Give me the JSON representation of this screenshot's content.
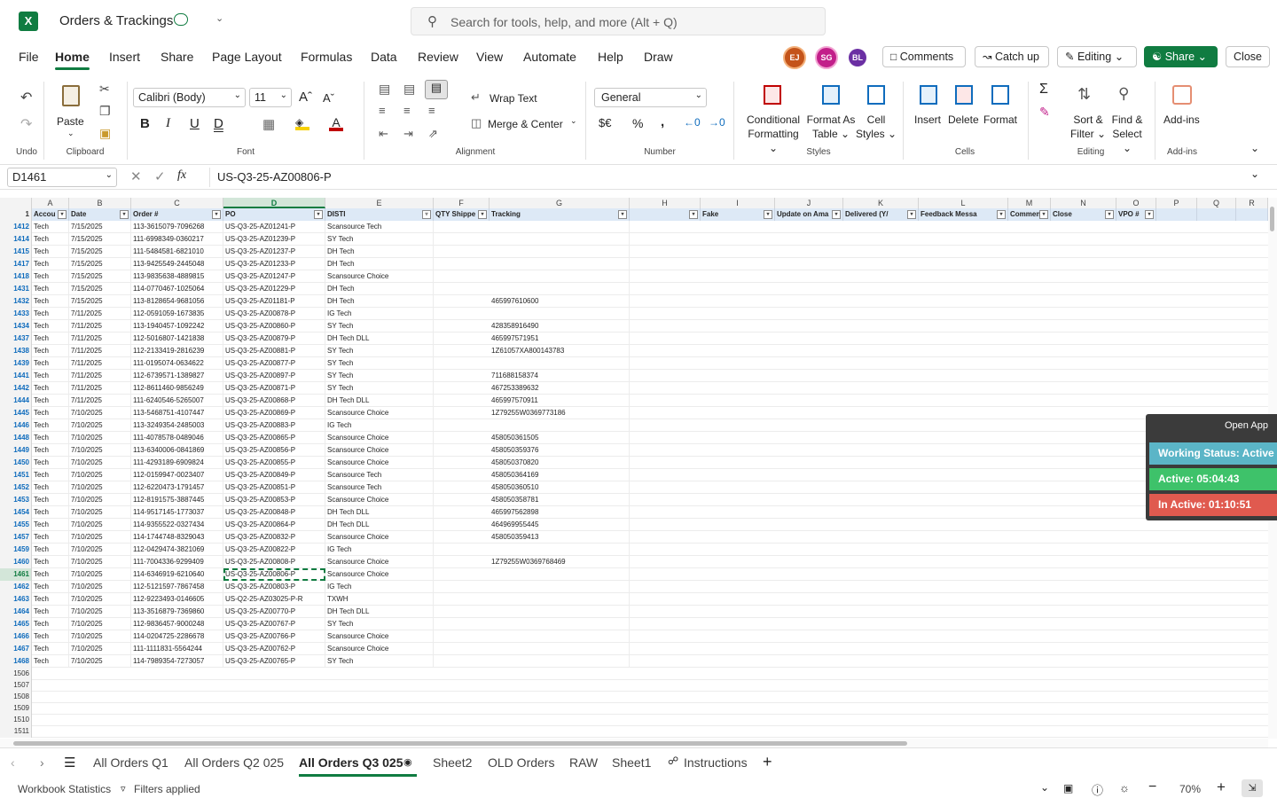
{
  "app": {
    "title": "Orders & Trackings",
    "search_placeholder": "Search for tools, help, and more (Alt + Q)",
    "brand_color": "#107c41"
  },
  "menu": [
    "File",
    "Home",
    "Insert",
    "Share",
    "Page Layout",
    "Formulas",
    "Data",
    "Review",
    "View",
    "Automate",
    "Help",
    "Draw"
  ],
  "active_menu": "Home",
  "avatars": [
    {
      "initials": "EJ",
      "color": "#c4541a"
    },
    {
      "initials": "SG",
      "color": "#c21f8a"
    },
    {
      "initials": "BL",
      "color": "#6b2fa3"
    }
  ],
  "header_buttons": {
    "comments": "Comments",
    "catchup": "Catch up",
    "editing": "Editing",
    "share": "Share",
    "close": "Close"
  },
  "ribbon": {
    "undo_label": "Undo",
    "clipboard_label": "Clipboard",
    "paste": "Paste",
    "font_label": "Font",
    "font_name": "Calibri (Body)",
    "font_size": "11",
    "alignment_label": "Alignment",
    "wrap_text": "Wrap Text",
    "merge_center": "Merge & Center",
    "number_label": "Number",
    "number_format": "General",
    "styles_label": "Styles",
    "conditional": "Conditional",
    "formatting": "Formatting",
    "format_as": "Format As",
    "table": "Table",
    "cell": "Cell",
    "styles": "Styles",
    "cells_label": "Cells",
    "insert": "Insert",
    "delete": "Delete",
    "format": "Format",
    "editing_label": "Editing",
    "sort1": "Sort &",
    "sort2": "Filter",
    "find1": "Find &",
    "find2": "Select",
    "addins_label": "Add-ins",
    "addins": "Add-ins"
  },
  "formula_bar": {
    "name_box": "D1461",
    "formula": "US-Q3-25-AZ00806-P"
  },
  "columns": [
    "A",
    "B",
    "C",
    "D",
    "E",
    "F",
    "G",
    "H",
    "I",
    "J",
    "K",
    "L",
    "M",
    "N",
    "O",
    "P",
    "Q",
    "R"
  ],
  "header_row": {
    "row_number": "1",
    "labels": [
      "Accou",
      "Date",
      "Order #",
      "PO",
      "DISTI",
      "QTY Shippe",
      "Tracking",
      "",
      "Fake",
      "Update on Ama",
      "Delivered (Y/",
      "Feedback Messa",
      "Comments",
      "Close",
      "VPO #",
      "",
      "",
      ""
    ]
  },
  "rows": [
    [
      "1412",
      "Tech",
      "7/15/2025",
      "113-3615079-7096268",
      "US-Q3-25-AZ01241-P",
      "Scansource Tech",
      ""
    ],
    [
      "1414",
      "Tech",
      "7/15/2025",
      "111-6998349-0360217",
      "US-Q3-25-AZ01239-P",
      "SY Tech",
      ""
    ],
    [
      "1415",
      "Tech",
      "7/15/2025",
      "111-5484581-6821010",
      "US-Q3-25-AZ01237-P",
      "DH Tech",
      ""
    ],
    [
      "1417",
      "Tech",
      "7/15/2025",
      "113-9425549-2445048",
      "US-Q3-25-AZ01233-P",
      "DH Tech",
      ""
    ],
    [
      "1418",
      "Tech",
      "7/15/2025",
      "113-9835638-4889815",
      "US-Q3-25-AZ01247-P",
      "Scansource Choice",
      ""
    ],
    [
      "1431",
      "Tech",
      "7/15/2025",
      "114-0770467-1025064",
      "US-Q3-25-AZ01229-P",
      "DH Tech",
      ""
    ],
    [
      "1432",
      "Tech",
      "7/15/2025",
      "113-8128654-9681056",
      "US-Q3-25-AZ01181-P",
      "DH Tech",
      "465997610600"
    ],
    [
      "1433",
      "Tech",
      "7/11/2025",
      "112-0591059-1673835",
      "US-Q3-25-AZ00878-P",
      "IG Tech",
      ""
    ],
    [
      "1434",
      "Tech",
      "7/11/2025",
      "113-1940457-1092242",
      "US-Q3-25-AZ00860-P",
      "SY Tech",
      "428358916490"
    ],
    [
      "1437",
      "Tech",
      "7/11/2025",
      "112-5016807-1421838",
      "US-Q3-25-AZ00879-P",
      "DH Tech DLL",
      "465997571951"
    ],
    [
      "1438",
      "Tech",
      "7/11/2025",
      "112-2133419-2816239",
      "US-Q3-25-AZ00881-P",
      "SY Tech",
      "1Z61057XA800143783"
    ],
    [
      "1439",
      "Tech",
      "7/11/2025",
      "111-0195074-0634622",
      "US-Q3-25-AZ00877-P",
      "SY Tech",
      ""
    ],
    [
      "1441",
      "Tech",
      "7/11/2025",
      "112-6739571-1389827",
      "US-Q3-25-AZ00897-P",
      "SY Tech",
      "711688158374"
    ],
    [
      "1442",
      "Tech",
      "7/11/2025",
      "112-8611460-9856249",
      "US-Q3-25-AZ00871-P",
      "SY Tech",
      "467253389632"
    ],
    [
      "1444",
      "Tech",
      "7/11/2025",
      "111-6240546-5265007",
      "US-Q3-25-AZ00868-P",
      "DH Tech DLL",
      "465997570911"
    ],
    [
      "1445",
      "Tech",
      "7/10/2025",
      "113-5468751-4107447",
      "US-Q3-25-AZ00869-P",
      "Scansource Choice",
      "1Z79255W0369773186"
    ],
    [
      "1446",
      "Tech",
      "7/10/2025",
      "113-3249354-2485003",
      "US-Q3-25-AZ00883-P",
      "IG Tech",
      ""
    ],
    [
      "1448",
      "Tech",
      "7/10/2025",
      "111-4078578-0489046",
      "US-Q3-25-AZ00865-P",
      "Scansource Choice",
      "458050361505"
    ],
    [
      "1449",
      "Tech",
      "7/10/2025",
      "113-6340006-0841869",
      "US-Q3-25-AZ00856-P",
      "Scansource Choice",
      "458050359376"
    ],
    [
      "1450",
      "Tech",
      "7/10/2025",
      "111-4293189-6909824",
      "US-Q3-25-AZ00855-P",
      "Scansource Choice",
      "458050370820"
    ],
    [
      "1451",
      "Tech",
      "7/10/2025",
      "112-0159947-0023407",
      "US-Q3-25-AZ00849-P",
      "Scansource Tech",
      "458050364169"
    ],
    [
      "1452",
      "Tech",
      "7/10/2025",
      "112-6220473-1791457",
      "US-Q3-25-AZ00851-P",
      "Scansource Tech",
      "458050360510"
    ],
    [
      "1453",
      "Tech",
      "7/10/2025",
      "112-8191575-3887445",
      "US-Q3-25-AZ00853-P",
      "Scansource Choice",
      "458050358781"
    ],
    [
      "1454",
      "Tech",
      "7/10/2025",
      "114-9517145-1773037",
      "US-Q3-25-AZ00848-P",
      "DH Tech DLL",
      "465997562898"
    ],
    [
      "1455",
      "Tech",
      "7/10/2025",
      "114-9355522-0327434",
      "US-Q3-25-AZ00864-P",
      "DH Tech DLL",
      "464969955445"
    ],
    [
      "1457",
      "Tech",
      "7/10/2025",
      "114-1744748-8329043",
      "US-Q3-25-AZ00832-P",
      "Scansource Choice",
      "458050359413"
    ],
    [
      "1459",
      "Tech",
      "7/10/2025",
      "112-0429474-3821069",
      "US-Q3-25-AZ00822-P",
      "IG Tech",
      ""
    ],
    [
      "1460",
      "Tech",
      "7/10/2025",
      "111-7004336-9299409",
      "US-Q3-25-AZ00808-P",
      "Scansource Choice",
      "1Z79255W0369768469"
    ],
    [
      "1461",
      "Tech",
      "7/10/2025",
      "114-6346919-6210640",
      "US-Q3-25-AZ00806-P",
      "Scansource Choice",
      ""
    ],
    [
      "1462",
      "Tech",
      "7/10/2025",
      "112-5121597-7867458",
      "US-Q3-25-AZ00803-P",
      "IG Tech",
      ""
    ],
    [
      "1463",
      "Tech",
      "7/10/2025",
      "112-9223493-0146605",
      "US-Q2-25-AZ03025-P-R",
      "TXWH",
      ""
    ],
    [
      "1464",
      "Tech",
      "7/10/2025",
      "113-3516879-7369860",
      "US-Q3-25-AZ00770-P",
      "DH Tech DLL",
      ""
    ],
    [
      "1465",
      "Tech",
      "7/10/2025",
      "112-9836457-9000248",
      "US-Q3-25-AZ00767-P",
      "SY Tech",
      ""
    ],
    [
      "1466",
      "Tech",
      "7/10/2025",
      "114-0204725-2286678",
      "US-Q3-25-AZ00766-P",
      "Scansource Choice",
      ""
    ],
    [
      "1467",
      "Tech",
      "7/10/2025",
      "111-1111831-5564244",
      "US-Q3-25-AZ00762-P",
      "Scansource Choice",
      ""
    ],
    [
      "1468",
      "Tech",
      "7/10/2025",
      "114-7989354-7273057",
      "US-Q3-25-AZ00765-P",
      "SY Tech",
      ""
    ]
  ],
  "empty_rows": [
    "1506",
    "1507",
    "1508",
    "1509",
    "1510",
    "1511"
  ],
  "overlay": {
    "open_app": "Open App",
    "status": "Working Status: Active",
    "active": "Active: 05:04:43",
    "inactive": "In Active: 01:10:51",
    "status_color": "#5bb5c7",
    "active_color": "#3ec26a",
    "inactive_color": "#e05a4f"
  },
  "sheet_tabs": [
    "All Orders Q1",
    "All Orders Q2 025",
    "All Orders Q3 025",
    "Sheet2",
    "OLD Orders",
    "RAW",
    "Sheet1",
    "Instructions"
  ],
  "active_sheet": "All Orders Q3 025",
  "statusbar": {
    "stats": "Workbook Statistics",
    "filters": "Filters applied",
    "zoom": "70%"
  }
}
